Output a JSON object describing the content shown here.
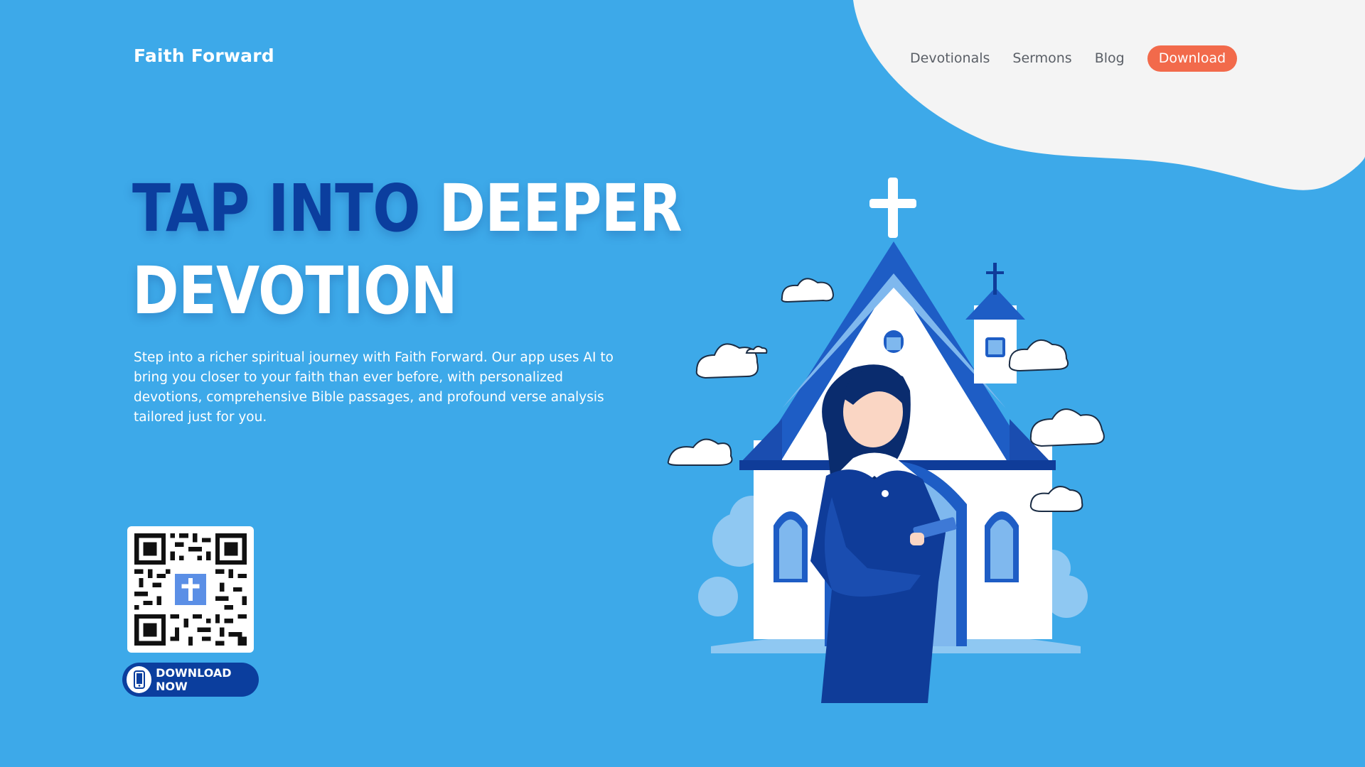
{
  "brand": {
    "name": "Faith Forward"
  },
  "nav": {
    "items": [
      {
        "label": "Devotionals"
      },
      {
        "label": "Sermons"
      },
      {
        "label": "Blog"
      }
    ],
    "download_label": "Download"
  },
  "hero": {
    "title_part1": "TAP INTO",
    "title_part2": "DEEPER",
    "title_line2": "DEVOTION",
    "description": "Step into a richer spiritual journey with Faith Forward. Our app uses AI to bring you closer to your faith than ever before, with personalized devotions, comprehensive Bible passages, and profound verse analysis tailored just for you."
  },
  "cta": {
    "download_now": "DOWNLOAD NOW"
  },
  "icons": {
    "qr": "qr-code-icon",
    "cross": "cross-icon",
    "phone": "phone-icon"
  },
  "colors": {
    "background": "#3DA9E9",
    "accent": "#F26A4B",
    "dark_blue": "#0B3E9E",
    "blob": "#F4F4F4"
  }
}
